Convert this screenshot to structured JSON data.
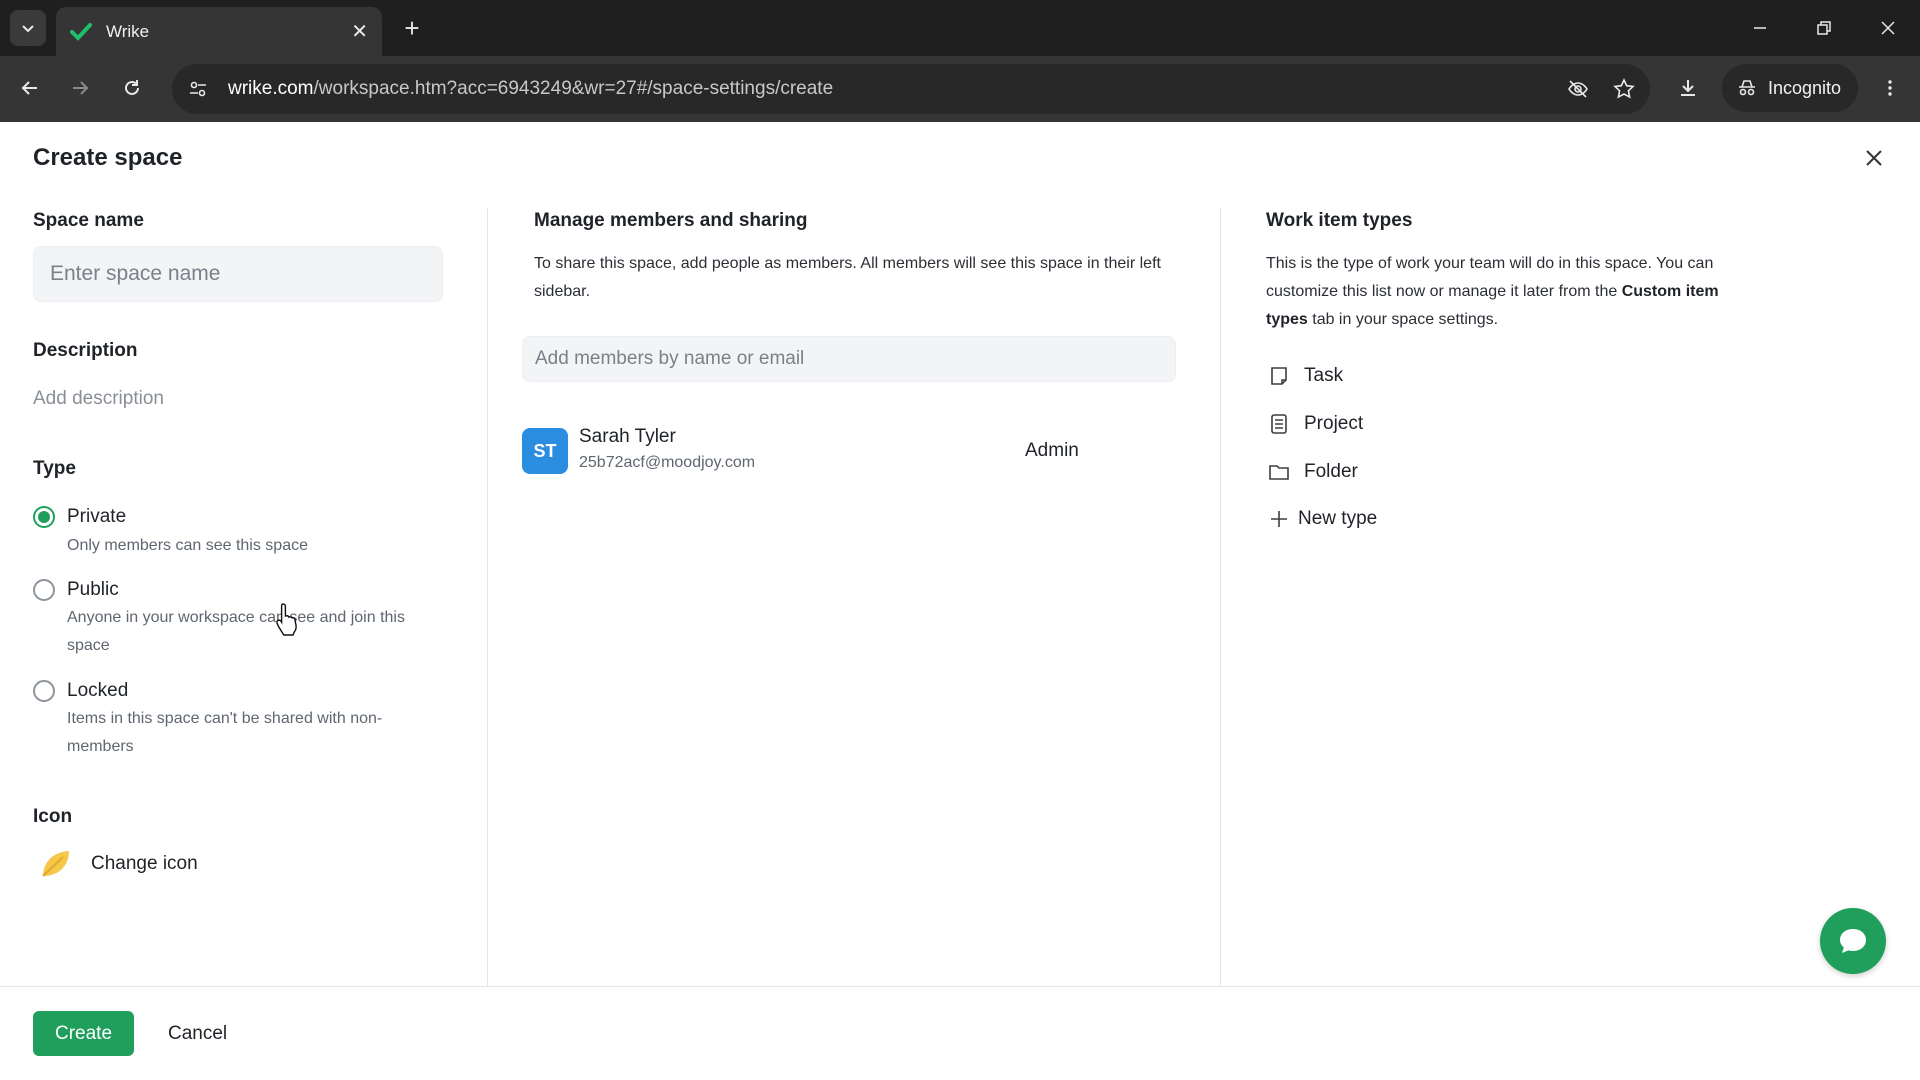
{
  "browser": {
    "tab_title": "Wrike",
    "url_domain": "wrike.com",
    "url_path": "/workspace.htm?acc=6943249&wr=27#/space-settings/create",
    "incognito_label": "Incognito"
  },
  "dialog": {
    "title": "Create space",
    "space_name": {
      "label": "Space name",
      "placeholder": "Enter space name",
      "value": ""
    },
    "description": {
      "label": "Description",
      "placeholder": "Add description"
    },
    "type": {
      "label": "Type",
      "selected": "Private",
      "options": [
        {
          "label": "Private",
          "desc": "Only members can see this space"
        },
        {
          "label": "Public",
          "desc": "Anyone in your workspace can see and join this space"
        },
        {
          "label": "Locked",
          "desc": "Items in this space can't be shared with non-members"
        }
      ]
    },
    "icon": {
      "label": "Icon",
      "change_label": "Change icon"
    },
    "members": {
      "title": "Manage members and sharing",
      "desc": "To share this space, add people as members. All members will see this space in their left sidebar.",
      "input_placeholder": "Add members by name or email",
      "list": [
        {
          "initials": "ST",
          "name": "Sarah Tyler",
          "email": "25b72acf@moodjoy.com",
          "role": "Admin"
        }
      ]
    },
    "work_item_types": {
      "title": "Work item types",
      "desc_before": "This is the type of work your team will do in this space. You can customize this list now or manage it later from the ",
      "desc_bold": "Custom item types",
      "desc_after": " tab in your space settings.",
      "items": [
        {
          "label": "Task",
          "icon": "task-icon"
        },
        {
          "label": "Project",
          "icon": "project-icon"
        },
        {
          "label": "Folder",
          "icon": "folder-icon"
        }
      ],
      "new_type_label": "New type"
    },
    "footer": {
      "create_label": "Create",
      "cancel_label": "Cancel"
    }
  },
  "colors": {
    "accent_green": "#1f9f5b",
    "avatar_blue": "#2b8de0"
  }
}
